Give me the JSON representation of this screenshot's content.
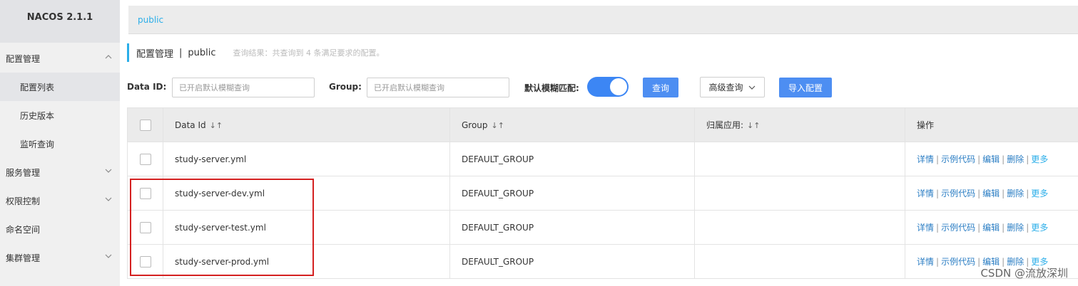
{
  "app": {
    "title": "NACOS 2.1.1"
  },
  "sidebar": {
    "items": [
      {
        "label": "配置管理",
        "expanded": true
      },
      {
        "label": "配置列表",
        "active": true
      },
      {
        "label": "历史版本"
      },
      {
        "label": "监听查询"
      },
      {
        "label": "服务管理"
      },
      {
        "label": "权限控制"
      },
      {
        "label": "命名空间"
      },
      {
        "label": "集群管理"
      }
    ]
  },
  "namespace_bar": {
    "current": "public"
  },
  "header": {
    "title": "配置管理",
    "separator": "|",
    "namespace": "public",
    "query_hint": "查询结果：共查询到 4 条满足要求的配置。"
  },
  "filters": {
    "data_id_label": "Data ID:",
    "data_id_placeholder": "已开启默认模糊查询",
    "group_label": "Group:",
    "group_placeholder": "已开启默认模糊查询",
    "fuzzy_label": "默认模糊匹配:",
    "fuzzy_on": true,
    "search_button": "查询",
    "advanced_button": "高级查询",
    "import_button": "导入配置"
  },
  "table": {
    "columns": [
      "Data Id",
      "Group",
      "归属应用:",
      "操作"
    ],
    "sort_glyph": "↓↑",
    "rows": [
      {
        "data_id": "study-server.yml",
        "group": "DEFAULT_GROUP",
        "app": ""
      },
      {
        "data_id": "study-server-dev.yml",
        "group": "DEFAULT_GROUP",
        "app": ""
      },
      {
        "data_id": "study-server-test.yml",
        "group": "DEFAULT_GROUP",
        "app": ""
      },
      {
        "data_id": "study-server-prod.yml",
        "group": "DEFAULT_GROUP",
        "app": ""
      }
    ],
    "actions": [
      "详情",
      "示例代码",
      "编辑",
      "删除",
      "更多"
    ]
  },
  "watermark": "CSDN @流放深圳",
  "colors": {
    "accent": "#2baee9",
    "primary_button": "#4d8ef2",
    "toggle": "#3c86f4",
    "highlight": "#d42020"
  }
}
